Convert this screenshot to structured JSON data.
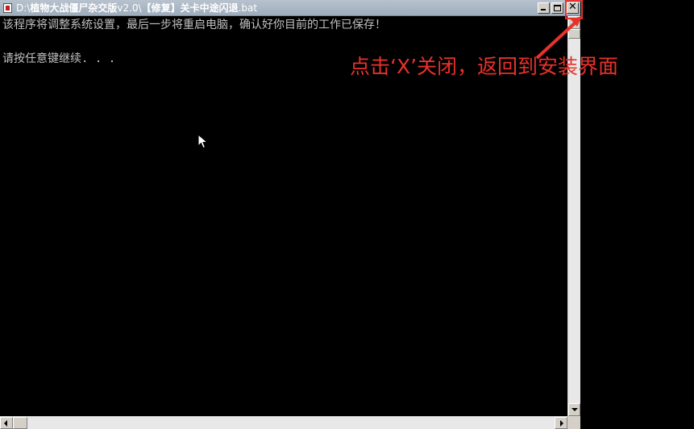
{
  "window": {
    "title_prefix": "D:\\",
    "title_bold_1": "植物大战僵尸杂交版",
    "title_mid": "v2.0\\",
    "title_bold_2": "【修复】关卡中途闪退",
    "title_suffix": ".bat",
    "close_glyph": "✕"
  },
  "console": {
    "line1": "该程序将调整系统设置，最后一步将重启电脑，确认好你目前的工作已保存！",
    "line2": "请按任意键继续. . ."
  },
  "annotation": {
    "text": "点击‘X’关闭，返回到安装界面",
    "color": "#e8312a"
  },
  "icons": {
    "app": "cmd-app-icon",
    "minimize": "minimize-icon",
    "maximize": "maximize-icon",
    "close": "close-icon",
    "cursor": "mouse-pointer-icon"
  }
}
